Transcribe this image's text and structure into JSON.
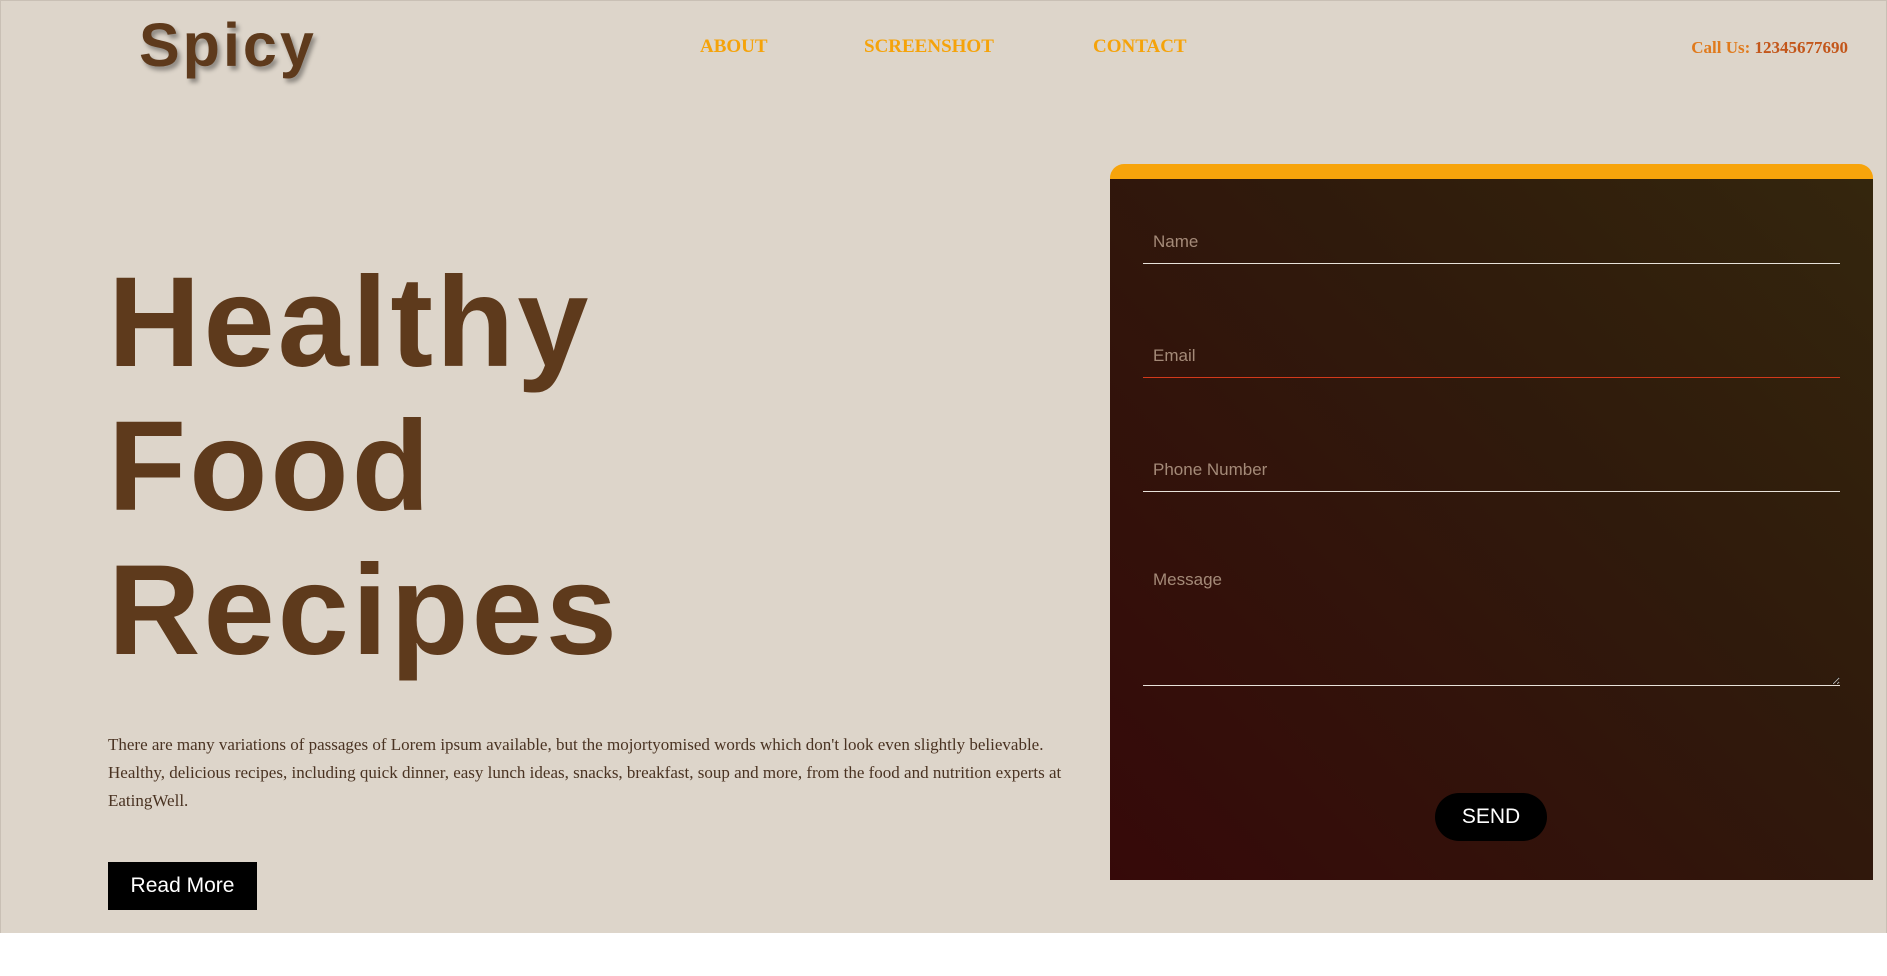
{
  "header": {
    "logo": "Spicy",
    "nav": [
      {
        "label": "ABOUT"
      },
      {
        "label": "SCREENSHOT"
      },
      {
        "label": "CONTACT"
      }
    ],
    "call_label": "Call Us:",
    "call_number": "12345677690"
  },
  "hero": {
    "title_lines": [
      "Healthy",
      "Food",
      "Recipes"
    ],
    "description": "There are many variations of passages of Lorem ipsum available, but the mojortyomised words which don't look even slightly believable. Healthy, delicious recipes, including quick dinner, easy lunch ideas, snacks, breakfast, soup and more, from the food and nutrition experts at EatingWell.",
    "read_more_label": "Read More"
  },
  "form": {
    "name_placeholder": "Name",
    "email_placeholder": "Email",
    "phone_placeholder": "Phone Number",
    "message_placeholder": "Message",
    "send_label": "SEND"
  },
  "colors": {
    "brand_brown": "#5e3a1c",
    "accent_orange": "#f7a40b",
    "hero_background": "#ddd5ca",
    "form_gradient": [
      "#360909",
      "#34260d"
    ]
  }
}
